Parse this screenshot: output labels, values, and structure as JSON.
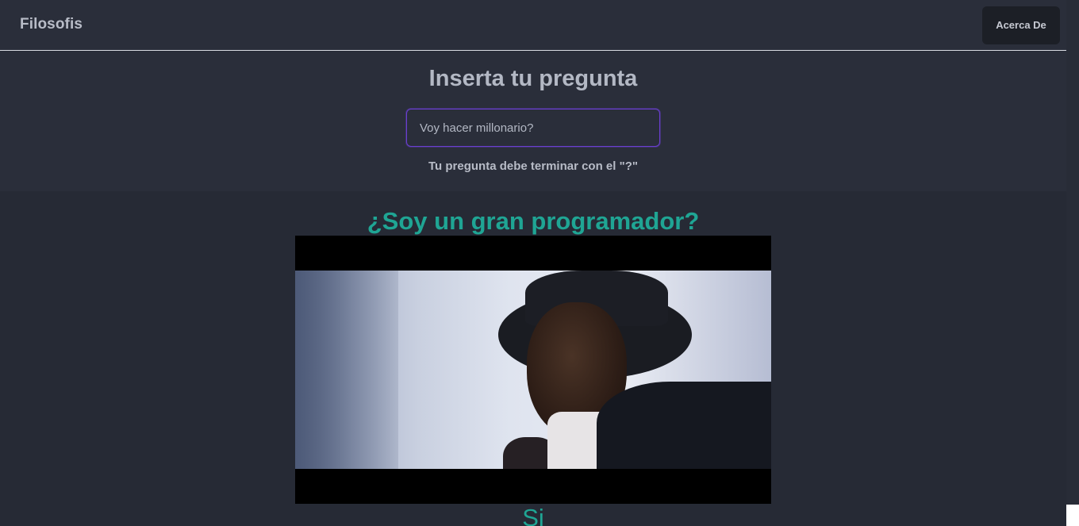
{
  "navbar": {
    "brand": "Filosofis",
    "about_label": "Acerca De"
  },
  "ask": {
    "title": "Inserta tu pregunta",
    "input_value": "Voy hacer millonario?",
    "hint": "Tu pregunta debe terminar con el \"?\""
  },
  "answer": {
    "question": "¿Soy un gran programador?",
    "gif_icon": "answer-gif-image",
    "text": "Si"
  },
  "colors": {
    "background": "#282c37",
    "accent": "#1fa594",
    "input_border": "#6a3fd0"
  }
}
